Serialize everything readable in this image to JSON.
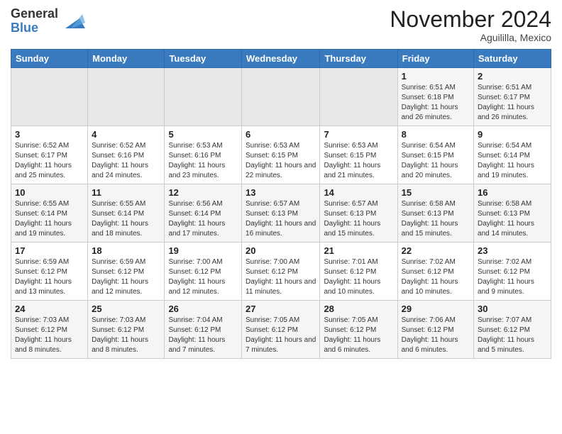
{
  "logo": {
    "general": "General",
    "blue": "Blue"
  },
  "title": "November 2024",
  "location": "Aguililla, Mexico",
  "weekdays": [
    "Sunday",
    "Monday",
    "Tuesday",
    "Wednesday",
    "Thursday",
    "Friday",
    "Saturday"
  ],
  "weeks": [
    [
      {
        "day": "",
        "empty": true
      },
      {
        "day": "",
        "empty": true
      },
      {
        "day": "",
        "empty": true
      },
      {
        "day": "",
        "empty": true
      },
      {
        "day": "",
        "empty": true
      },
      {
        "day": "1",
        "sunrise": "Sunrise: 6:51 AM",
        "sunset": "Sunset: 6:18 PM",
        "daylight": "Daylight: 11 hours and 26 minutes."
      },
      {
        "day": "2",
        "sunrise": "Sunrise: 6:51 AM",
        "sunset": "Sunset: 6:17 PM",
        "daylight": "Daylight: 11 hours and 26 minutes."
      }
    ],
    [
      {
        "day": "3",
        "sunrise": "Sunrise: 6:52 AM",
        "sunset": "Sunset: 6:17 PM",
        "daylight": "Daylight: 11 hours and 25 minutes."
      },
      {
        "day": "4",
        "sunrise": "Sunrise: 6:52 AM",
        "sunset": "Sunset: 6:16 PM",
        "daylight": "Daylight: 11 hours and 24 minutes."
      },
      {
        "day": "5",
        "sunrise": "Sunrise: 6:53 AM",
        "sunset": "Sunset: 6:16 PM",
        "daylight": "Daylight: 11 hours and 23 minutes."
      },
      {
        "day": "6",
        "sunrise": "Sunrise: 6:53 AM",
        "sunset": "Sunset: 6:15 PM",
        "daylight": "Daylight: 11 hours and 22 minutes."
      },
      {
        "day": "7",
        "sunrise": "Sunrise: 6:53 AM",
        "sunset": "Sunset: 6:15 PM",
        "daylight": "Daylight: 11 hours and 21 minutes."
      },
      {
        "day": "8",
        "sunrise": "Sunrise: 6:54 AM",
        "sunset": "Sunset: 6:15 PM",
        "daylight": "Daylight: 11 hours and 20 minutes."
      },
      {
        "day": "9",
        "sunrise": "Sunrise: 6:54 AM",
        "sunset": "Sunset: 6:14 PM",
        "daylight": "Daylight: 11 hours and 19 minutes."
      }
    ],
    [
      {
        "day": "10",
        "sunrise": "Sunrise: 6:55 AM",
        "sunset": "Sunset: 6:14 PM",
        "daylight": "Daylight: 11 hours and 19 minutes."
      },
      {
        "day": "11",
        "sunrise": "Sunrise: 6:55 AM",
        "sunset": "Sunset: 6:14 PM",
        "daylight": "Daylight: 11 hours and 18 minutes."
      },
      {
        "day": "12",
        "sunrise": "Sunrise: 6:56 AM",
        "sunset": "Sunset: 6:14 PM",
        "daylight": "Daylight: 11 hours and 17 minutes."
      },
      {
        "day": "13",
        "sunrise": "Sunrise: 6:57 AM",
        "sunset": "Sunset: 6:13 PM",
        "daylight": "Daylight: 11 hours and 16 minutes."
      },
      {
        "day": "14",
        "sunrise": "Sunrise: 6:57 AM",
        "sunset": "Sunset: 6:13 PM",
        "daylight": "Daylight: 11 hours and 15 minutes."
      },
      {
        "day": "15",
        "sunrise": "Sunrise: 6:58 AM",
        "sunset": "Sunset: 6:13 PM",
        "daylight": "Daylight: 11 hours and 15 minutes."
      },
      {
        "day": "16",
        "sunrise": "Sunrise: 6:58 AM",
        "sunset": "Sunset: 6:13 PM",
        "daylight": "Daylight: 11 hours and 14 minutes."
      }
    ],
    [
      {
        "day": "17",
        "sunrise": "Sunrise: 6:59 AM",
        "sunset": "Sunset: 6:12 PM",
        "daylight": "Daylight: 11 hours and 13 minutes."
      },
      {
        "day": "18",
        "sunrise": "Sunrise: 6:59 AM",
        "sunset": "Sunset: 6:12 PM",
        "daylight": "Daylight: 11 hours and 12 minutes."
      },
      {
        "day": "19",
        "sunrise": "Sunrise: 7:00 AM",
        "sunset": "Sunset: 6:12 PM",
        "daylight": "Daylight: 11 hours and 12 minutes."
      },
      {
        "day": "20",
        "sunrise": "Sunrise: 7:00 AM",
        "sunset": "Sunset: 6:12 PM",
        "daylight": "Daylight: 11 hours and 11 minutes."
      },
      {
        "day": "21",
        "sunrise": "Sunrise: 7:01 AM",
        "sunset": "Sunset: 6:12 PM",
        "daylight": "Daylight: 11 hours and 10 minutes."
      },
      {
        "day": "22",
        "sunrise": "Sunrise: 7:02 AM",
        "sunset": "Sunset: 6:12 PM",
        "daylight": "Daylight: 11 hours and 10 minutes."
      },
      {
        "day": "23",
        "sunrise": "Sunrise: 7:02 AM",
        "sunset": "Sunset: 6:12 PM",
        "daylight": "Daylight: 11 hours and 9 minutes."
      }
    ],
    [
      {
        "day": "24",
        "sunrise": "Sunrise: 7:03 AM",
        "sunset": "Sunset: 6:12 PM",
        "daylight": "Daylight: 11 hours and 8 minutes."
      },
      {
        "day": "25",
        "sunrise": "Sunrise: 7:03 AM",
        "sunset": "Sunset: 6:12 PM",
        "daylight": "Daylight: 11 hours and 8 minutes."
      },
      {
        "day": "26",
        "sunrise": "Sunrise: 7:04 AM",
        "sunset": "Sunset: 6:12 PM",
        "daylight": "Daylight: 11 hours and 7 minutes."
      },
      {
        "day": "27",
        "sunrise": "Sunrise: 7:05 AM",
        "sunset": "Sunset: 6:12 PM",
        "daylight": "Daylight: 11 hours and 7 minutes."
      },
      {
        "day": "28",
        "sunrise": "Sunrise: 7:05 AM",
        "sunset": "Sunset: 6:12 PM",
        "daylight": "Daylight: 11 hours and 6 minutes."
      },
      {
        "day": "29",
        "sunrise": "Sunrise: 7:06 AM",
        "sunset": "Sunset: 6:12 PM",
        "daylight": "Daylight: 11 hours and 6 minutes."
      },
      {
        "day": "30",
        "sunrise": "Sunrise: 7:07 AM",
        "sunset": "Sunset: 6:12 PM",
        "daylight": "Daylight: 11 hours and 5 minutes."
      }
    ]
  ]
}
